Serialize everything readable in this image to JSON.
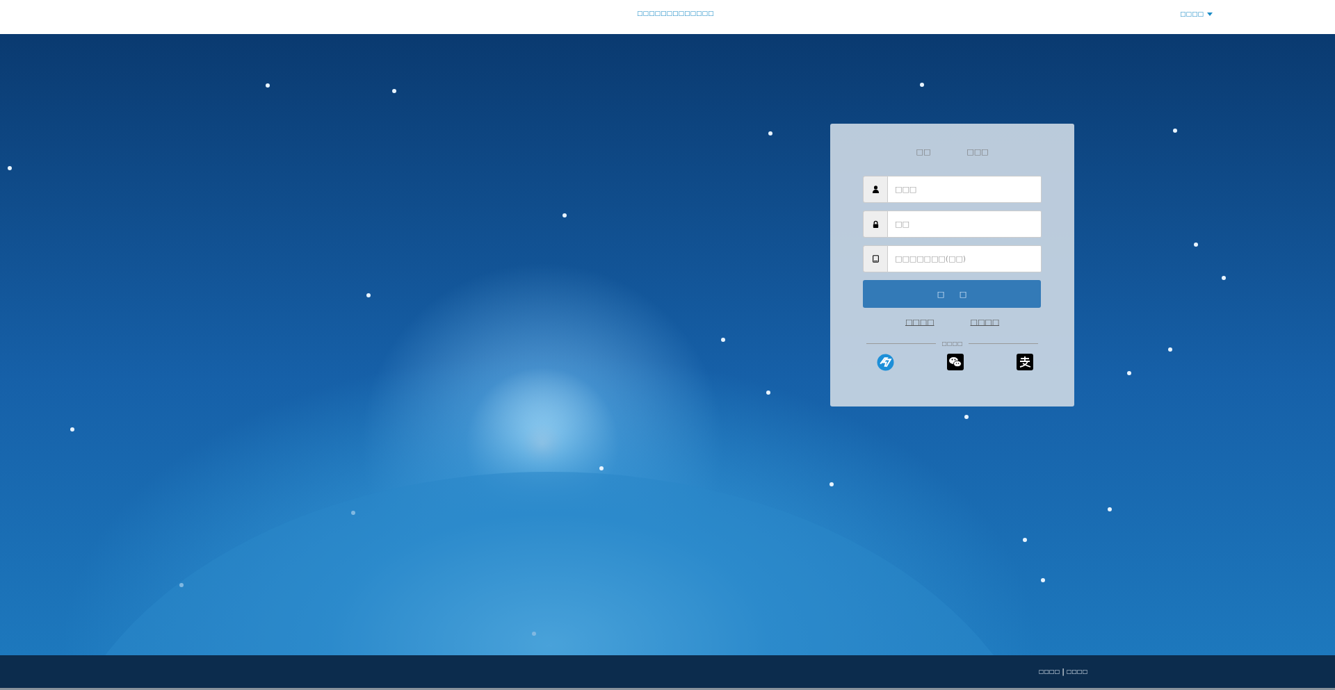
{
  "header": {
    "title": "□□□□□□□□□□□□□",
    "menu_label": "□□□□"
  },
  "login": {
    "tabs": [
      {
        "label": "□□"
      },
      {
        "label": "□□□"
      }
    ],
    "fields": [
      {
        "kind": "user",
        "placeholder": "□□□"
      },
      {
        "kind": "lock",
        "placeholder": "□□"
      },
      {
        "kind": "tablet",
        "placeholder": "□□□□□□□(□□)"
      }
    ],
    "submit": "□ □",
    "links": [
      "□□□□",
      "□□□□"
    ],
    "divider_label": "□□□□",
    "social": [
      {
        "kind": "logo"
      },
      {
        "kind": "chat"
      },
      {
        "kind": "pay"
      }
    ]
  },
  "footer": {
    "links": [
      "□□□□",
      "□□□□"
    ],
    "separator": "|"
  }
}
